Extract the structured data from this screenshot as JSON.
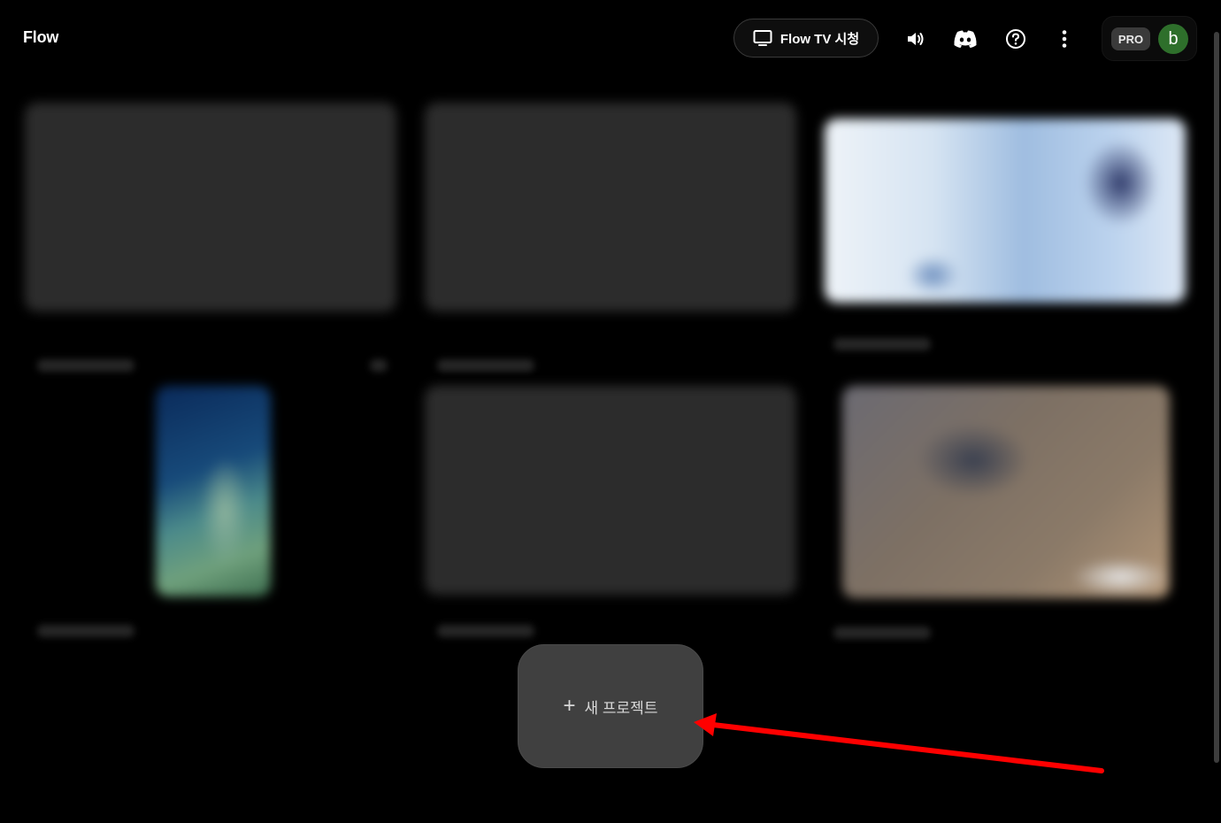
{
  "header": {
    "title": "Flow",
    "tv_button_label": "Flow TV 시청",
    "plan_badge": "PRO",
    "avatar_initial": "b"
  },
  "main": {
    "new_project_label": "새 프로젝트"
  },
  "icons": {
    "tv": "tv-icon",
    "volume": "volume-icon",
    "discord": "discord-icon",
    "help": "help-icon",
    "more": "more-vert-icon",
    "plus": "plus-icon"
  },
  "colors": {
    "background": "#000000",
    "avatar": "#2e6f2b",
    "button": "#404040",
    "annotation_arrow": "#ff0000"
  }
}
